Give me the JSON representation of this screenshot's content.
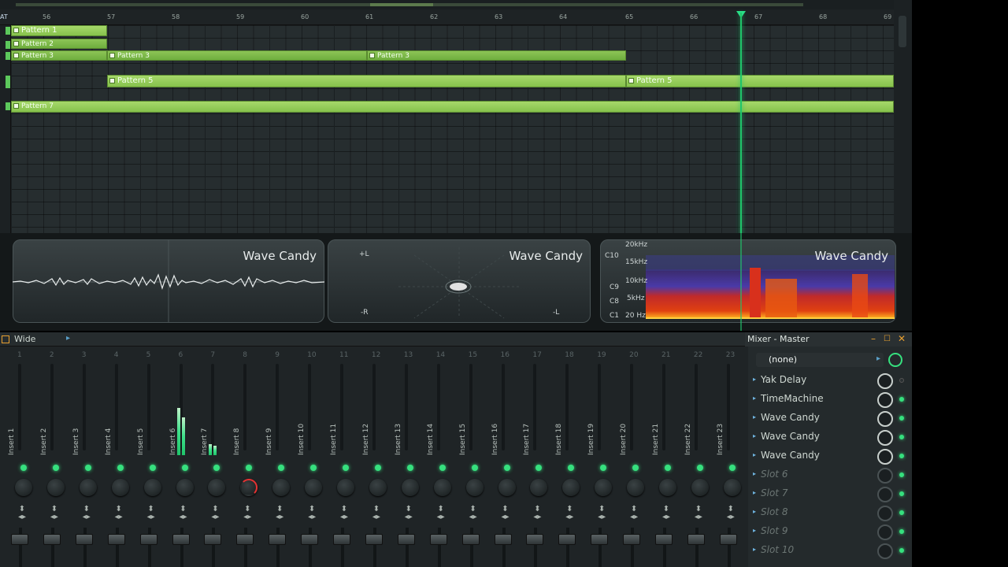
{
  "playlist": {
    "bar_numbers": [
      "56",
      "57",
      "58",
      "59",
      "60",
      "61",
      "62",
      "63",
      "64",
      "65",
      "66",
      "67",
      "68",
      "69"
    ],
    "ruler_left_label": "AT",
    "clips": [
      {
        "label": "Pattern 1"
      },
      {
        "label": "Pattern 2"
      },
      {
        "label": "Pattern 3"
      },
      {
        "label": "Pattern 3"
      },
      {
        "label": "Pattern 3"
      },
      {
        "label": "Pattern 5"
      },
      {
        "label": "Pattern 5"
      },
      {
        "label": "Pattern 7"
      }
    ]
  },
  "viz": {
    "oscilloscope_title": "Wave Candy",
    "vectorscope_title": "Wave Candy",
    "vectorscope_labels": [
      "+L",
      "-R",
      "-L"
    ],
    "spectrogram_title": "Wave Candy",
    "spectrogram_notes": [
      "C10",
      "C9",
      "C8",
      "C1"
    ],
    "spectrogram_freqs": [
      "20kHz",
      "15kHz",
      "10kHz",
      "5kHz",
      "20 Hz"
    ]
  },
  "mixer": {
    "layout_label": "Wide",
    "title": "Mixer - Master",
    "insert_numbers": [
      "1",
      "2",
      "3",
      "4",
      "5",
      "6",
      "7",
      "8",
      "9",
      "10",
      "11",
      "12",
      "13",
      "14",
      "15",
      "16",
      "17",
      "18",
      "19",
      "20",
      "21",
      "22",
      "23"
    ],
    "inserts": [
      "Insert 1",
      "Insert 2",
      "Insert 3",
      "Insert 4",
      "Insert 5",
      "Insert 6",
      "Insert 7",
      "Insert 8",
      "Insert 9",
      "Insert 10",
      "Insert 11",
      "Insert 12",
      "Insert 13",
      "Insert 14",
      "Insert 15",
      "Insert 16",
      "Insert 17",
      "Insert 18",
      "Insert 19",
      "Insert 20",
      "Insert 21",
      "Insert 22",
      "Insert 23"
    ],
    "preset": "(none)",
    "slots": [
      {
        "name": "Yak Delay",
        "empty": false
      },
      {
        "name": "TimeMachine",
        "empty": false
      },
      {
        "name": "Wave Candy",
        "empty": false
      },
      {
        "name": "Wave Candy",
        "empty": false
      },
      {
        "name": "Wave Candy",
        "empty": false
      },
      {
        "name": "Slot 6",
        "empty": true
      },
      {
        "name": "Slot 7",
        "empty": true
      },
      {
        "name": "Slot 8",
        "empty": true
      },
      {
        "name": "Slot 9",
        "empty": true
      },
      {
        "name": "Slot 10",
        "empty": true
      }
    ],
    "colors": {
      "accent_green": "#36e07e",
      "clip_green": "#86c24c",
      "playhead": "#1fc46a"
    }
  }
}
